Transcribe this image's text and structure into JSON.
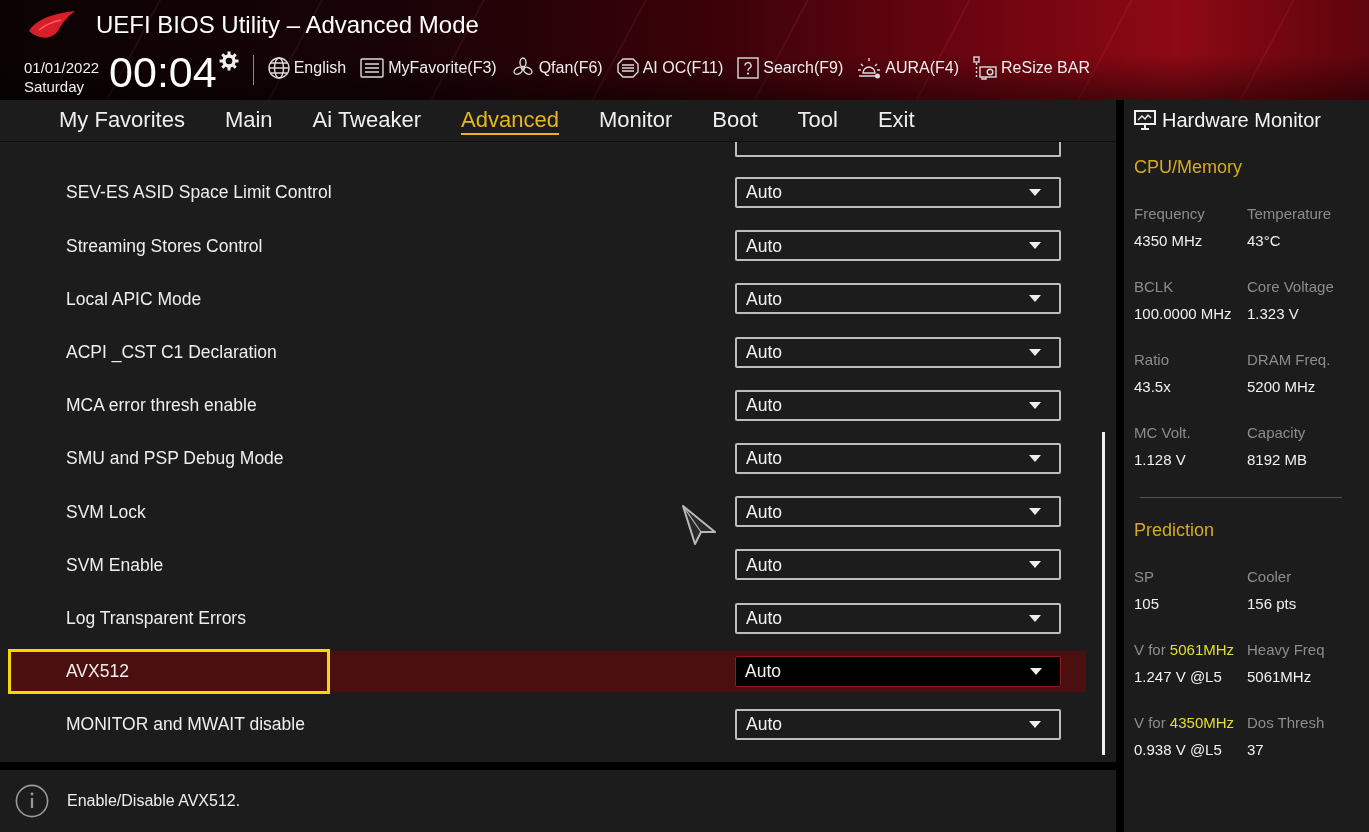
{
  "header": {
    "title": "UEFI BIOS Utility – Advanced Mode",
    "date": "01/01/2022",
    "day": "Saturday",
    "time": "00:04",
    "tools": [
      {
        "kind": "language",
        "label": "English"
      },
      {
        "kind": "favorite",
        "label": "MyFavorite(F3)"
      },
      {
        "kind": "fan",
        "label": "Qfan(F6)"
      },
      {
        "kind": "ai",
        "label": "AI OC(F11)"
      },
      {
        "kind": "search",
        "label": "Search(F9)"
      },
      {
        "kind": "aura",
        "label": "AURA(F4)"
      },
      {
        "kind": "resize",
        "label": "ReSize BAR"
      }
    ]
  },
  "tabs": [
    {
      "label": "My Favorites",
      "selected": false
    },
    {
      "label": "Main",
      "selected": false
    },
    {
      "label": "Ai Tweaker",
      "selected": false
    },
    {
      "label": "Advanced",
      "selected": true
    },
    {
      "label": "Monitor",
      "selected": false
    },
    {
      "label": "Boot",
      "selected": false
    },
    {
      "label": "Tool",
      "selected": false
    },
    {
      "label": "Exit",
      "selected": false
    }
  ],
  "settings": {
    "rows": [
      {
        "label": "SEV-ES ASID Space Limit Control",
        "value": "Auto",
        "selected": false,
        "annotated": false
      },
      {
        "label": "Streaming Stores Control",
        "value": "Auto",
        "selected": false,
        "annotated": false
      },
      {
        "label": "Local APIC Mode",
        "value": "Auto",
        "selected": false,
        "annotated": false
      },
      {
        "label": "ACPI _CST C1 Declaration",
        "value": "Auto",
        "selected": false,
        "annotated": false
      },
      {
        "label": "MCA error thresh enable",
        "value": "Auto",
        "selected": false,
        "annotated": false
      },
      {
        "label": "SMU and PSP Debug Mode",
        "value": "Auto",
        "selected": false,
        "annotated": false
      },
      {
        "label": "SVM Lock",
        "value": "Auto",
        "selected": false,
        "annotated": false
      },
      {
        "label": "SVM Enable",
        "value": "Auto",
        "selected": false,
        "annotated": false
      },
      {
        "label": "Log Transparent Errors",
        "value": "Auto",
        "selected": false,
        "annotated": false
      },
      {
        "label": "AVX512",
        "value": "Auto",
        "selected": true,
        "annotated": true
      },
      {
        "label": "MONITOR and MWAIT disable",
        "value": "Auto",
        "selected": false,
        "annotated": false
      }
    ]
  },
  "help": {
    "text": "Enable/Disable AVX512."
  },
  "hardware_monitor": {
    "title": "Hardware Monitor",
    "sections": [
      {
        "title": "CPU/Memory",
        "items": [
          {
            "label": "Frequency",
            "value": "4350 MHz"
          },
          {
            "label": "Temperature",
            "value": "43°C"
          },
          {
            "label": "BCLK",
            "value": "100.0000 MHz"
          },
          {
            "label": "Core Voltage",
            "value": "1.323 V"
          },
          {
            "label": "Ratio",
            "value": "43.5x"
          },
          {
            "label": "DRAM Freq.",
            "value": "5200 MHz"
          },
          {
            "label": "MC Volt.",
            "value": "1.128 V"
          },
          {
            "label": "Capacity",
            "value": "8192 MB"
          }
        ]
      },
      {
        "title": "Prediction",
        "items": [
          {
            "label": "SP",
            "value": "105"
          },
          {
            "label": "Cooler",
            "value": "156 pts"
          },
          {
            "label": "V for",
            "label_highlight": "5061MHz",
            "value": "1.247 V @L5"
          },
          {
            "label": "Heavy Freq",
            "value": "5061MHz"
          },
          {
            "label": "V for",
            "label_highlight": "4350MHz",
            "value": "0.938 V @L5"
          },
          {
            "label": "Dos Thresh",
            "value": "37"
          }
        ]
      }
    ]
  }
}
